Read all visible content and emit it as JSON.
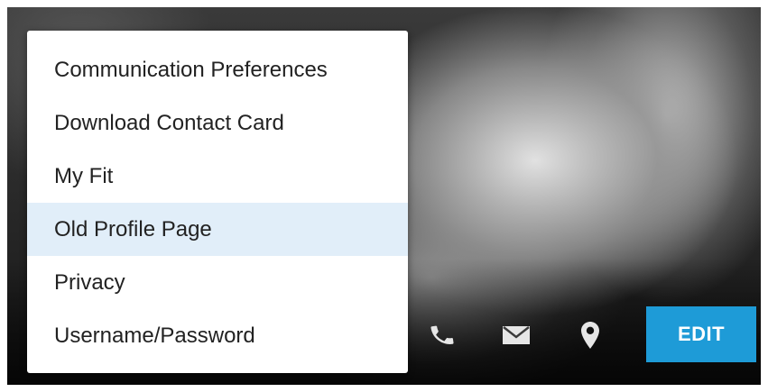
{
  "menu": {
    "items": [
      {
        "label": "Communication Preferences"
      },
      {
        "label": "Download Contact Card"
      },
      {
        "label": "My Fit"
      },
      {
        "label": "Old Profile Page",
        "highlighted": true
      },
      {
        "label": "Privacy"
      },
      {
        "label": "Username/Password"
      }
    ],
    "highlight_color": "#e1eef9"
  },
  "actions": {
    "icons": [
      "phone-icon",
      "mail-icon",
      "map-pin-icon"
    ],
    "icon_color": "#e6e6e6",
    "edit_label": "EDIT",
    "edit_color": "#1e9bd7"
  }
}
